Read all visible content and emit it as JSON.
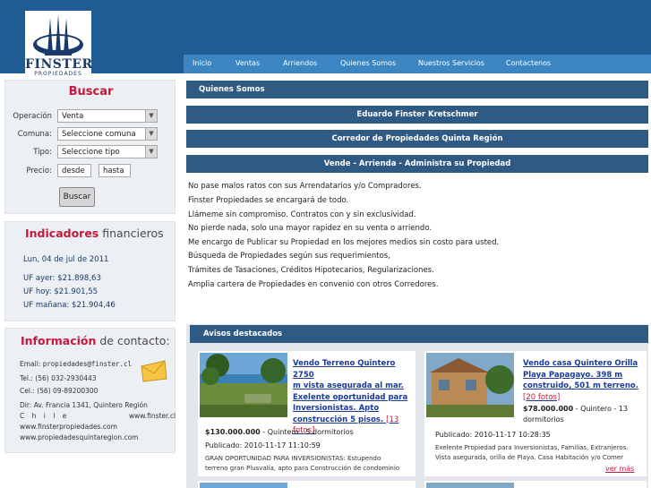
{
  "logo": {
    "name": "FINSTER",
    "sub": "PROPIEDADES"
  },
  "nav": [
    "Inicio",
    "Ventas",
    "Arriendos",
    "Quienes Somos",
    "Nuestros Servicios",
    "Contactenos"
  ],
  "search": {
    "title": "Buscar",
    "operacion_label": "Operación",
    "operacion_value": "Venta",
    "comuna_label": "Comuna:",
    "comuna_value": "Seleccione comuna",
    "tipo_label": "Tipo:",
    "tipo_value": "Seleccione tipo",
    "precio_label": "Precio:",
    "desde": "desde",
    "hasta": "hasta",
    "button": "Buscar"
  },
  "indicadores": {
    "title_bold": "Indicadores",
    "title_rest": " financieros",
    "date": "Lun, 04 de jul de 2011",
    "uf_ayer": "UF ayer: $21.898,63",
    "uf_hoy": "UF hoy: $21.901,55",
    "uf_manana": "UF mañana: $21.904,46"
  },
  "info": {
    "title_bold": "Información",
    "title_rest": " de contacto:",
    "email_label": "Email:",
    "email": "propiedades@finster.cl",
    "tel": "Tel.: (56) 032-2930443",
    "cel": "Cel.: (56) 09-89200300",
    "dir1": "Dir: Av. Francia 1341, Quintero Región",
    "dir2_left": "C  h  i  l  e",
    "dir2_right": "www.finster.cl",
    "web1": "www.finsterpropiedades.com",
    "web2": "www.propiedadesquintaregion.com"
  },
  "main": {
    "quienes": "Quienes Somos",
    "name": "Eduardo Finster Kretschmer",
    "corredor": "Corredor de Propiedades Quinta Región",
    "vende": "Vende - Arrienda - Administra su Propiedad",
    "paragraph": [
      "No pase malos ratos con sus Arrendatarios y/o Compradores.",
      "Finster Propiedades se encargará de todo.",
      "Llámeme sin compromiso. Contratos con y sin exclusividad.",
      "No pierde nada, solo una mayor rapidez en su venta o arriendo.",
      "Me encargo de Publicar su Propiedad en los mejores medios sin costo para usted.",
      "Búsqueda de Propiedades según sus requerimientos,",
      "Trámites de Tasaciones, Créditos Hipotecarios, Regularizaciones.",
      "Amplia cartera de Propiedades en convenio con otros Corredores."
    ]
  },
  "avisos": {
    "title": "Avisos destacados",
    "ver_mas": "ver más",
    "cards": [
      {
        "title_lines": [
          "Vendo Terreno Quintero 2750",
          "m vista asegurada al mar.",
          "Exelente oportunidad para",
          "Inversionistas. Apto",
          "construcción 5 pisos."
        ],
        "fotos_a": "[13",
        "fotos_b": "fotos]",
        "price": "$130.000.000",
        "price_rest": " - Quintero - 5 dormitorios",
        "published": "Publicado: 2010-11-17 11:10:59",
        "desc1": "GRAN OPORTUNIDAD PARA INVERSIONISTAS: Estupendo",
        "desc2": "terreno gran Plusvalía, apto para Construcción de condominio"
      },
      {
        "title_lines": [
          "Vendo casa Quintero Orilla",
          "Playa Papagayo. 398 m",
          "construido, 501 m terreno."
        ],
        "fotos": "[20 fotos]",
        "price": "$78.000.000",
        "price_mid": " - Quintero - 13",
        "price_rest": "dormitorios",
        "published": "Publicado: 2010-11-17 10:28:35",
        "desc1": "Exelente Propiedad para Inversionistas, Familias, Extranjeros.",
        "desc2": "Vista asegurada, orilla de Playa. Casa Habitación y/o Comer"
      }
    ]
  }
}
